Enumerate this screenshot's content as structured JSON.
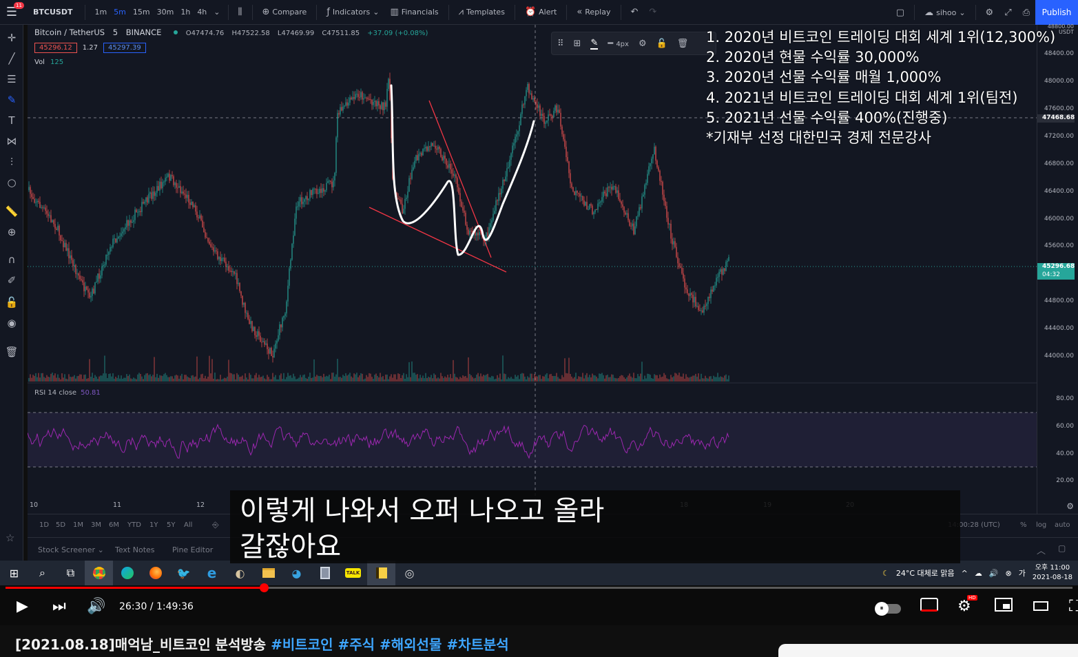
{
  "tradingview": {
    "menu_badge": "11",
    "symbol": "BTCUSDT",
    "timeframes": [
      {
        "label": "1m",
        "active": false
      },
      {
        "label": "5m",
        "active": true
      },
      {
        "label": "15m",
        "active": false
      },
      {
        "label": "30m",
        "active": false
      },
      {
        "label": "1h",
        "active": false
      },
      {
        "label": "4h",
        "active": false
      }
    ],
    "toolbar": {
      "compare": "Compare",
      "indicators": "Indicators",
      "financials": "Financials",
      "templates": "Templates",
      "alert": "Alert",
      "replay": "Replay",
      "user": "sihoo",
      "publish": "Publish"
    },
    "legend": {
      "title": "Bitcoin / TetherUS",
      "interval": "5",
      "exchange": "BINANCE",
      "open": "O47474.76",
      "high": "H47522.58",
      "low": "L47469.99",
      "close": "C47511.85",
      "change": "+37.09 (+0.08%)",
      "bid": "45296.12",
      "spread": "1.27",
      "ask": "45297.39",
      "vol_label": "Vol",
      "vol_value": "125"
    },
    "rsi_legend": {
      "label": "RSI 14 close",
      "value": "50.81"
    },
    "floating_toolbar": {
      "width_label": "4px"
    },
    "price_scale": {
      "top_labels": [
        "48800.00",
        "USDT"
      ],
      "labels": [
        "48400.00",
        "48000.00",
        "47600.00",
        "47200.00",
        "46800.00",
        "46400.00",
        "46000.00",
        "45600.00",
        "44800.00",
        "44400.00",
        "44000.00"
      ],
      "crosshair_price": "47468.68",
      "last_price": "45296.68",
      "countdown": "04:32",
      "rsi_labels": [
        "80.00",
        "60.00",
        "40.00",
        "20.00"
      ]
    },
    "time_labels": [
      "10",
      "11",
      "12",
      "18",
      "19",
      "20"
    ],
    "range_buttons": [
      "1D",
      "5D",
      "1M",
      "3M",
      "6M",
      "YTD",
      "1Y",
      "5Y",
      "All"
    ],
    "bottom_right": {
      "time": "14:00:28 (UTC)",
      "percent": "%",
      "log": "log",
      "auto": "auto"
    },
    "footer_tabs": [
      "Stock Screener",
      "Text Notes",
      "Pine Editor"
    ]
  },
  "overlay_lines": [
    "1. 2020년 비트코인 트레이딩 대회 세계 1위(12,300%)",
    "2. 2020년 현물 수익률 30,000%",
    "3. 2020년 선물 수익률 매월 1,000%",
    "4. 2021년 비트코인 트레이딩 대회 세계 1위(팀전)",
    "5. 2021년 선물 수익률 400%(진행중)",
    "*기재부 선정 대한민국 경제 전문강사"
  ],
  "subtitle": {
    "line1": "이렇게 나와서 오퍼 나오고 올라",
    "line2": "갈잖아요"
  },
  "taskbar": {
    "weather": "24°C 대체로 맑음",
    "clock_time": "오후 11:00",
    "clock_date": "2021-08-18",
    "kakao": "TALK"
  },
  "player": {
    "current_time": "26:30",
    "duration": "1:49:36",
    "progress_fraction": 0.2418,
    "hd_badge": "HD"
  },
  "video": {
    "title_prefix": "[2021.08.18]매억남_비트코인 분석방송",
    "tags": [
      "#비트코인",
      "#주식",
      "#해외선물",
      "#차트분석"
    ]
  },
  "colors": {
    "tv_background": "#131722",
    "up_candle": "#26a69a",
    "down_candle": "#ef5350",
    "rsi_line": "#9c27b0",
    "accent": "#2962ff",
    "yt_red": "#ff0000",
    "trendline": "#f23645",
    "drawing": "#ffffff"
  }
}
